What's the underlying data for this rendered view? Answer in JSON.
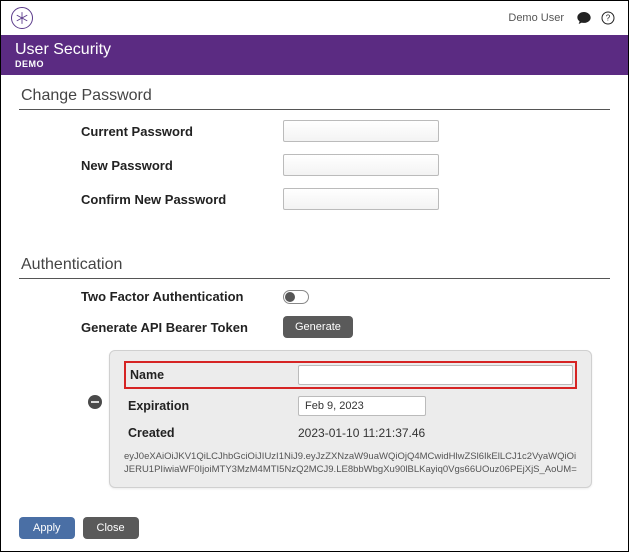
{
  "topbar": {
    "user": "Demo User"
  },
  "banner": {
    "title": "User Security",
    "subtitle": "DEMO"
  },
  "sections": {
    "change_password": {
      "heading": "Change Password",
      "fields": {
        "current": "Current Password",
        "new": "New Password",
        "confirm": "Confirm New Password"
      }
    },
    "authentication": {
      "heading": "Authentication",
      "two_factor_label": "Two Factor Authentication",
      "two_factor_on": false,
      "generate_label": "Generate API Bearer Token",
      "generate_button": "Generate"
    }
  },
  "token": {
    "name_label": "Name",
    "name_value": "",
    "expiration_label": "Expiration",
    "expiration_value": "Feb 9, 2023",
    "created_label": "Created",
    "created_value": "2023-01-10 11:21:37.46",
    "token_string": "eyJ0eXAiOiJKV1QiLCJhbGciOiJIUzI1NiJ9.eyJzZXNzaW9uaWQiOjQ4MCwidHlwZSl6IkElLCJ1c2VyaWQiOiJERU1PIiwiaWF0IjoiMTY3MzM4MTI5NzQ2MCJ9.LE8bbWbgXu90lBLKayiq0Vgs66UOuz06PEjXjS_AoUM="
  },
  "footer": {
    "apply": "Apply",
    "close": "Close"
  }
}
